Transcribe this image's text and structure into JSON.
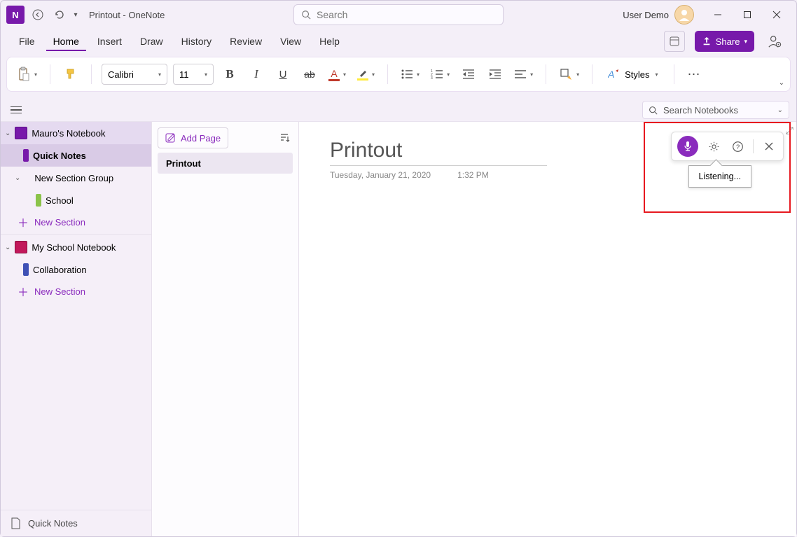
{
  "title": "Printout  -  OneNote",
  "search": {
    "placeholder": "Search"
  },
  "user": {
    "name": "User Demo"
  },
  "menu": {
    "file": "File",
    "home": "Home",
    "insert": "Insert",
    "draw": "Draw",
    "history": "History",
    "review": "Review",
    "view": "View",
    "help": "Help"
  },
  "share_label": "Share",
  "ribbon": {
    "font": "Calibri",
    "size": "11",
    "styles": "Styles"
  },
  "notebook_search": {
    "placeholder": "Search Notebooks"
  },
  "sidebar": {
    "nb1": "Mauro's Notebook",
    "quick_notes": "Quick Notes",
    "new_sec_group": "New Section Group",
    "school": "School",
    "new_section": "New Section",
    "nb2": "My  School Notebook",
    "collab": "Collaboration",
    "footer": "Quick Notes"
  },
  "pages": {
    "add_page": "Add Page",
    "p1": "Printout"
  },
  "page": {
    "title": "Printout",
    "date": "Tuesday, January 21, 2020",
    "time": "1:32 PM"
  },
  "dictate": {
    "tooltip": "Listening..."
  }
}
